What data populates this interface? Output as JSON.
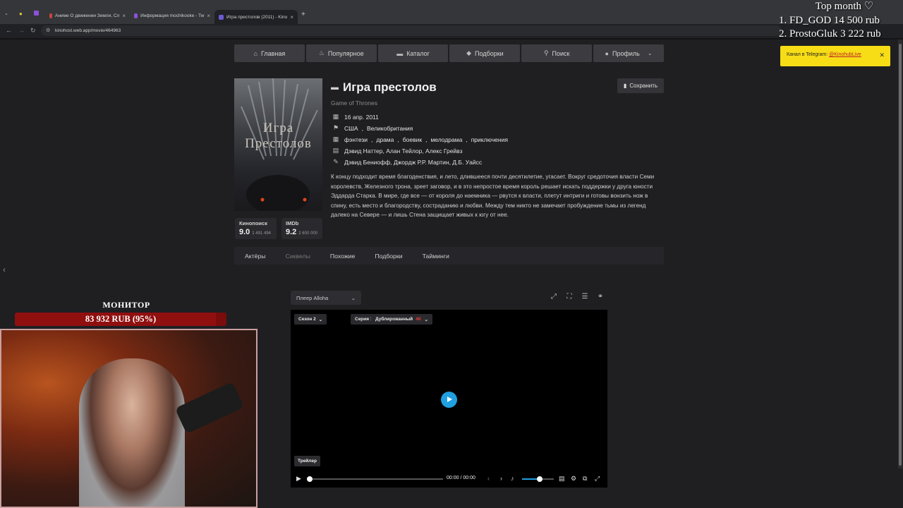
{
  "browser": {
    "tabs": [
      {
        "title": "Аниме О движении Земли, Сл",
        "color": "#c9453b"
      },
      {
        "title": "Информация mochikooke - Tw",
        "color": "#8a52d6"
      },
      {
        "title": "Игра престолов (2011) - Kino",
        "color": "#6a5bd3"
      }
    ],
    "url": "kinohost.web.app/movie/464963",
    "new_tab": "+",
    "close": "×"
  },
  "nav": [
    {
      "label": "Главная",
      "icon": "home-icon"
    },
    {
      "label": "Популярное",
      "icon": "fire-icon"
    },
    {
      "label": "Каталог",
      "icon": "folder-icon"
    },
    {
      "label": "Подборки",
      "icon": "collections-icon"
    },
    {
      "label": "Поиск",
      "icon": "search-icon"
    },
    {
      "label": "Профиль",
      "icon": "user-icon"
    }
  ],
  "movie": {
    "poster_title": "Игра\nПрестолов",
    "title": "Игра престолов",
    "original_title": "Game of Thrones",
    "save_label": "Сохранить",
    "date": "16 апр. 2011",
    "countries": [
      "США",
      "Великобритания"
    ],
    "genres": [
      "фэнтези",
      "драма",
      "боевик",
      "мелодрама",
      "приключения"
    ],
    "cast": "Дэвид Наттер, Алан Тейлор, Алекс Грейвз",
    "writers": "Дэвид Бениофф, Джордж Р.Р. Мартин, Д.Б. Уайсс",
    "description": "К концу подходит время благоденствия, и лето, длившееся почти десятилетие, угасает. Вокруг средоточия власти Семи королевств, Железного трона, зреет заговор, и в это непростое время король решает искать поддержки у друга юности Эддарда Старка. В мире, где все — от короля до наемника — рвутся к власти, плетут интриги и готовы вонзить нож в спину, есть место и благородству, состраданию и любви. Между тем никто не замечает пробуждение тьмы из легенд далеко на Севере — и лишь Стена защищает живых к югу от нее.",
    "ratings": [
      {
        "label": "Кинопоиск",
        "value": "9.0",
        "count": "1 491 494"
      },
      {
        "label": "IMDb",
        "value": "9.2",
        "count": "2 600 000"
      }
    ]
  },
  "tabs": [
    "Актёры",
    "Сиквелы",
    "Похожие",
    "Подборки",
    "Тайминги"
  ],
  "player": {
    "source": "Плеер Alloha",
    "season": "Сезон 2",
    "episode": "Серия 1",
    "voice": "Дублированный",
    "quality": "4K",
    "trailer": "Трейлер",
    "time": "00:00  /  00:00",
    "volume_level": 0.52
  },
  "overlay": {
    "top_month_title": "Top month ♡",
    "top_month_lines": [
      "1. FD_GOD 14 500 rub",
      "2. ProstoGluk 3 222 rub"
    ],
    "telegram_text": "Канал в Telegram: ",
    "telegram_link": "@KinohubLive",
    "monitor_title": "МОНИТОР",
    "monitor_value": "83 932 RUB (95%)",
    "monitor_progress": 0.95
  }
}
